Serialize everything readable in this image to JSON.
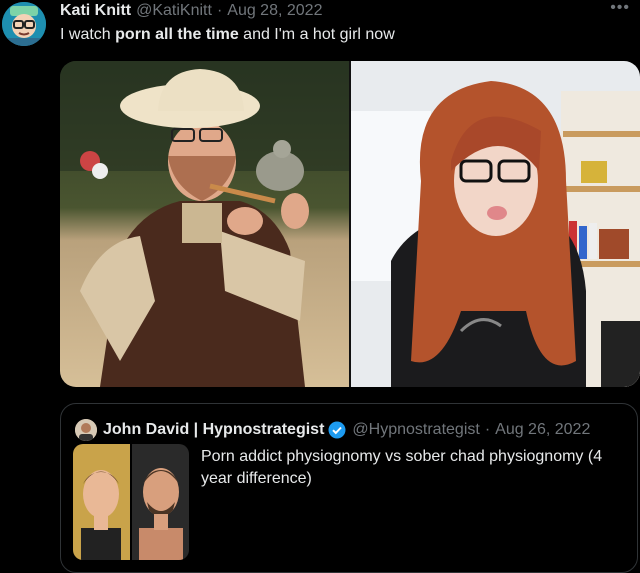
{
  "tweet": {
    "author_name": "Kati Knitt",
    "handle": "@KatiKnitt",
    "separator": "·",
    "date": "Aug 28, 2022",
    "more_icon": "more-horizontal-icon",
    "text_parts": [
      "I watch ",
      "porn all the time",
      " and I'm a hot girl now"
    ],
    "media": [
      {
        "name": "photo-man-safari-hat-turtle"
      },
      {
        "name": "photo-woman-red-hair-glasses"
      }
    ]
  },
  "quote": {
    "author_name": "John David | Hypnostrategist",
    "verified_icon": "verified-badge-icon",
    "handle": "@Hypnostrategist",
    "separator": "·",
    "date": "Aug 26, 2022",
    "text": "Porn addict physiognomy vs sober chad physiognomy (4 year difference)"
  },
  "colors": {
    "background": "#000000",
    "text_primary": "#e7e9ea",
    "text_secondary": "#71767b",
    "border": "#2f3336",
    "verified_blue": "#1d9bf0"
  }
}
